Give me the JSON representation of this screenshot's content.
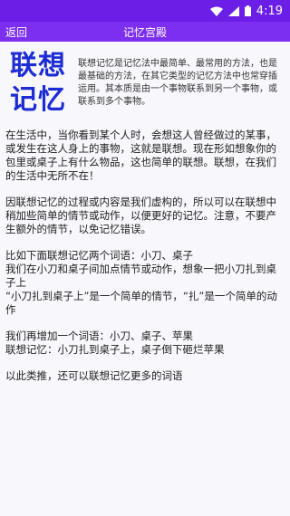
{
  "status": {
    "time": "4:19"
  },
  "appbar": {
    "back_label": "返回",
    "title": "记忆宫殿"
  },
  "intro": {
    "heading_line1": "联想",
    "heading_line2": "记忆",
    "text": "联想记忆是记忆法中最简单、最常用的方法，也是最基础的方法，在其它类型的记忆方法中也常穿插运用。其本质是由一个事物联系到另一个事物，或联系到多个事物。"
  },
  "paragraphs": [
    "在生活中，当你看到某个人时，会想这人曾经做过的某事，或发生在这人身上的事物，这就是联想。现在形如想象你的包里或桌子上有什么物品，这也简单的联想。联想，在我们的生活中无所不在！",
    "因联想记忆的过程或内容是我们虚构的，所以可以在联想中稍加些简单的情节或动作，以便更好的记忆。注意，不要产生额外的情节，以免记忆错误。",
    "比如下面联想记忆两个词语：小刀、桌子\n我们在小刀和桌子间加点情节或动作，想象一把小刀扎到桌子上\n“小刀扎到桌子上”是一个简单的情节，“扎”是一个简单的动作",
    "我们再增加一个词语：小刀、桌子、苹果\n联想记忆：小刀扎到桌子上，桌子倒下砸烂苹果",
    "以此类推，还可以联想记忆更多的词语"
  ]
}
